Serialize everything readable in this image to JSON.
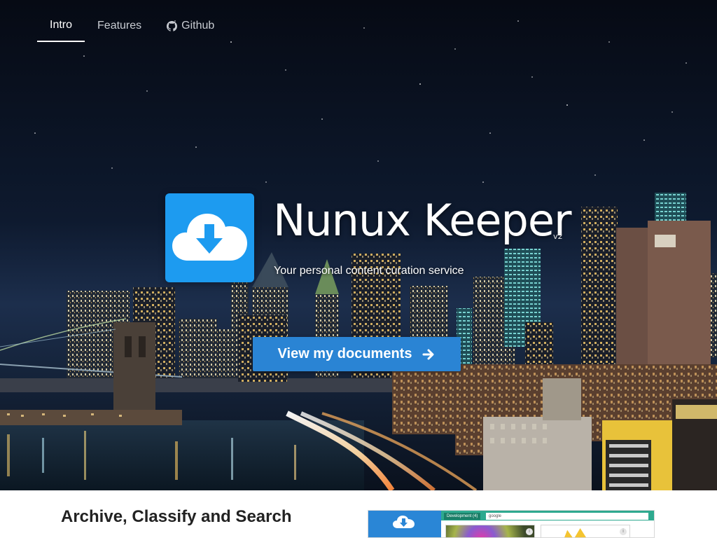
{
  "nav": {
    "items": [
      {
        "label": "Intro",
        "active": true
      },
      {
        "label": "Features",
        "active": false
      },
      {
        "label": "Github",
        "active": false,
        "icon": "github-icon"
      }
    ]
  },
  "brand": {
    "logo_icon": "cloud-download-icon",
    "title": "Nunux Keeper",
    "version": "v2",
    "tagline": "Your personal content curation service"
  },
  "cta": {
    "label": "View my documents",
    "icon": "arrow-right-icon"
  },
  "section": {
    "heading": "Archive, Classify and Search"
  },
  "preview": {
    "tag_label": "Development (4)",
    "search_value": "google",
    "info_glyph": "i"
  },
  "colors": {
    "accent": "#2a84d4",
    "logo": "#1d9bf0",
    "preview_sidebar": "#2a86d6",
    "preview_topbar": "#2ea98f"
  }
}
